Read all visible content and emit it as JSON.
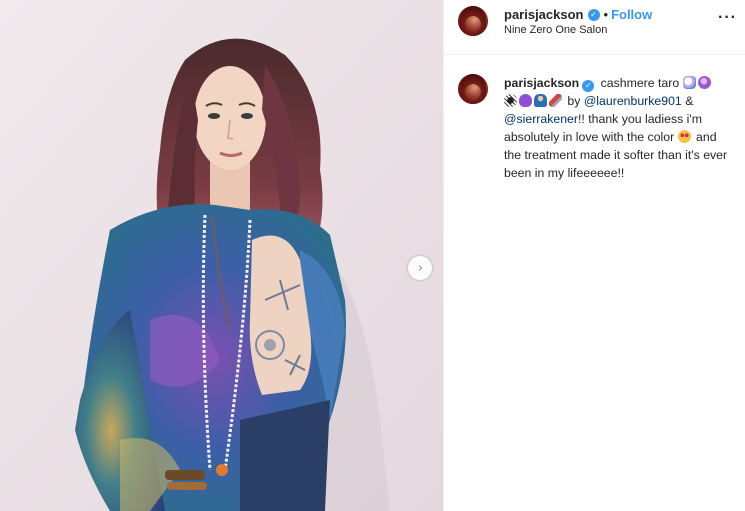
{
  "post": {
    "username": "parisjackson",
    "verified": true,
    "follow_label": "Follow",
    "separator": "•",
    "location": "Nine Zero One Salon",
    "more_label": "···"
  },
  "caption": {
    "username": "parisjackson",
    "text_1": " cashmere taro ",
    "text_2": " by ",
    "mention_1": "@laurenburke901",
    "text_3": " & ",
    "mention_2": "@sierrakener",
    "text_4": "!! thank you ladiess i'm absolutely in love with the color ",
    "text_5": " and the treatment made it softer than it's ever been in my lifeeeeee!!",
    "emojis": [
      "unicorn",
      "crystal-ball",
      "spider-web",
      "purple-heart",
      "mage",
      "syringe",
      "heart-eyes"
    ]
  },
  "carousel": {
    "next_label": "›"
  },
  "colors": {
    "accent": "#3897f0",
    "mention": "#003569",
    "text": "#262626",
    "border": "#efefef"
  }
}
